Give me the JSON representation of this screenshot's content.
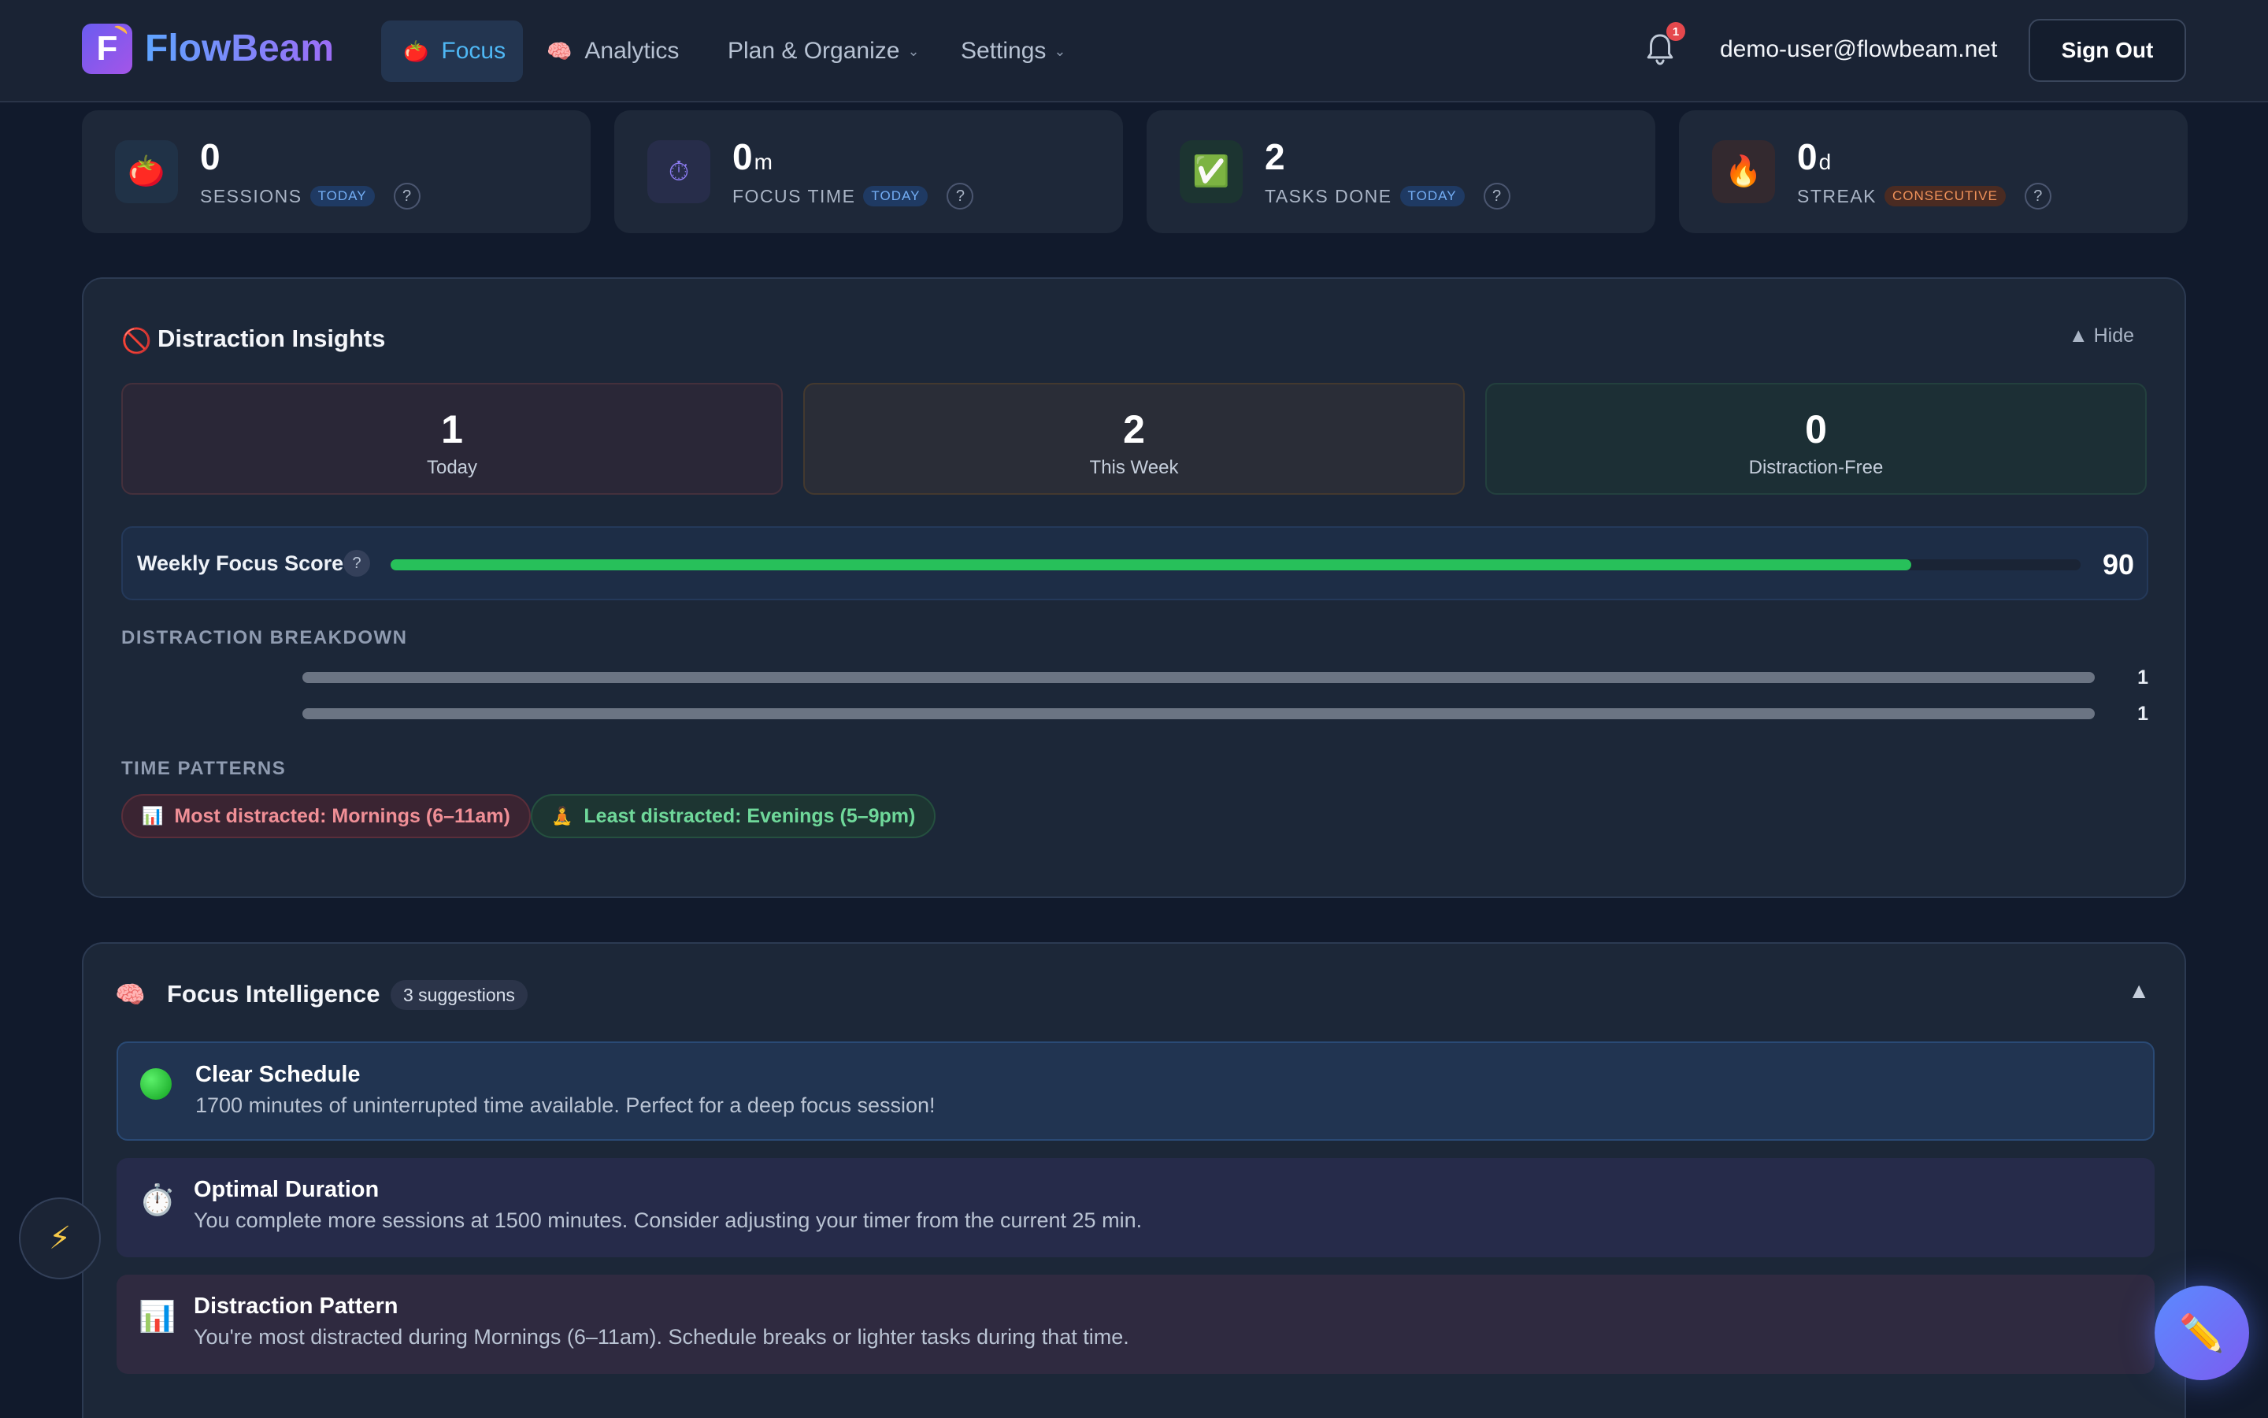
{
  "header": {
    "logo_letter": "F",
    "brand": "FlowBeam",
    "nav": [
      {
        "icon": "🍅",
        "label": "Focus"
      },
      {
        "icon": "🧠",
        "label": "Analytics"
      },
      {
        "label": "Plan & Organize"
      },
      {
        "label": "Settings"
      }
    ],
    "notification_count": "1",
    "user_email": "demo-user@flowbeam.net",
    "sign_out_label": "Sign Out"
  },
  "stats": [
    {
      "icon": "🍅",
      "value": "0",
      "unit": "",
      "label": "SESSIONS",
      "tag": "TODAY",
      "help": "?"
    },
    {
      "icon": "⏱",
      "value": "0",
      "unit": "m",
      "label": "FOCUS TIME",
      "tag": "TODAY",
      "help": "?"
    },
    {
      "icon": "✅",
      "value": "2",
      "unit": "",
      "label": "TASKS DONE",
      "tag": "TODAY",
      "help": "?"
    },
    {
      "icon": "🔥",
      "value": "0",
      "unit": "d",
      "label": "STREAK",
      "tag": "CONSECUTIVE",
      "help": "?"
    }
  ],
  "insights": {
    "icon": "🚫",
    "title": "Distraction Insights",
    "hide_label": "▲ Hide",
    "metrics": [
      {
        "value": "1",
        "label": "Today"
      },
      {
        "value": "2",
        "label": "This Week"
      },
      {
        "value": "0",
        "label": "Distraction-Free"
      }
    ],
    "focus_score": {
      "label": "Weekly Focus Score",
      "help": "?",
      "value": "90",
      "fill_fraction": 0.9
    },
    "breakdown_heading": "DISTRACTION BREAKDOWN",
    "breakdown": [
      {
        "count": "1",
        "fill_fraction": 1.0
      },
      {
        "count": "1",
        "fill_fraction": 1.0
      }
    ],
    "patterns_heading": "TIME PATTERNS",
    "patterns": [
      {
        "icon": "📊",
        "text": "Most distracted: Mornings (6–11am)"
      },
      {
        "icon": "🧘",
        "text": "Least distracted: Evenings (5–9pm)"
      }
    ]
  },
  "intelligence": {
    "icon": "🧠",
    "title": "Focus Intelligence",
    "badge": "3 suggestions",
    "collapse_icon": "▲",
    "suggestions": [
      {
        "icon": "green-circle",
        "title": "Clear Schedule",
        "text": "1700 minutes of uninterrupted time available. Perfect for a deep focus session!"
      },
      {
        "icon": "⏱️",
        "title": "Optimal Duration",
        "text": "You complete more sessions at 1500 minutes. Consider adjusting your timer from the current 25 min."
      },
      {
        "icon": "📊",
        "title": "Distraction Pattern",
        "text": "You're most distracted during Mornings (6–11am). Schedule breaks or lighter tasks during that time."
      }
    ]
  },
  "fab_left_icon": "⚡",
  "fab_right_icon": "✏️"
}
